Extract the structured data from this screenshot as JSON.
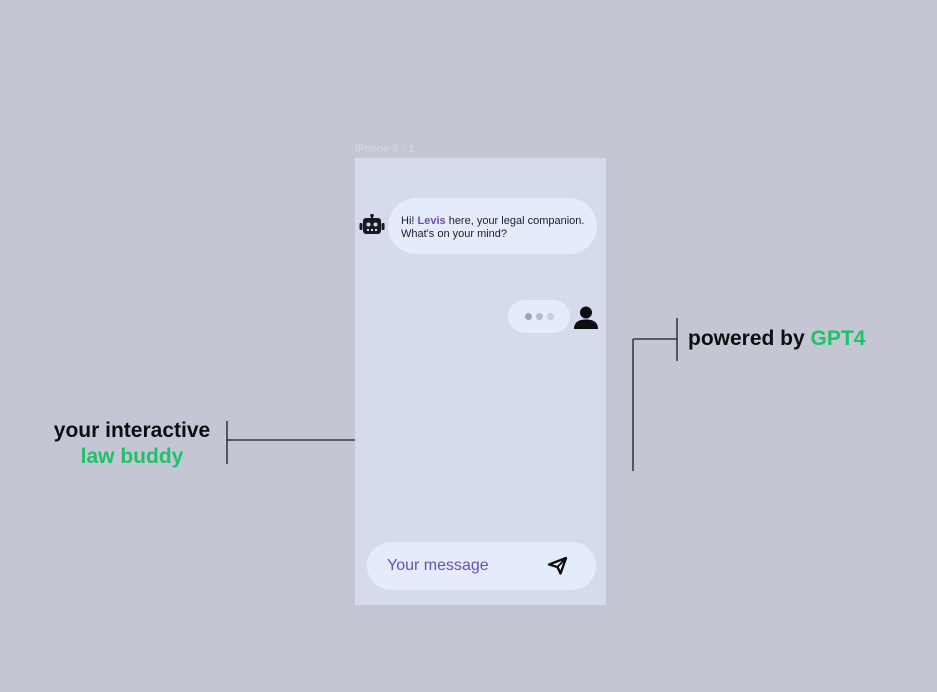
{
  "frame": {
    "label": "iPhone 8 - 1"
  },
  "chat": {
    "bot_message": {
      "greeting": "Hi! ",
      "name": "Levis",
      "rest_line1": " here, your legal companion.",
      "line2": "What's on your mind?"
    },
    "typing_indicator": {
      "dots": 3
    },
    "input": {
      "placeholder": "Your message",
      "value": ""
    }
  },
  "callouts": {
    "left": {
      "line1": "your interactive",
      "line2": "law buddy"
    },
    "right": {
      "prefix": "powered by ",
      "highlight": "GPT4"
    }
  },
  "colors": {
    "background": "#c4c6d4",
    "phone": "#d5dbec",
    "bubble": "#e4ebfb",
    "brand_purple": "#6a4fb6",
    "accent_green": "#1ec26a",
    "text_dark": "#0e0e12"
  },
  "icons": {
    "bot": "robot-icon",
    "user": "user-icon",
    "send": "paper-plane-icon"
  }
}
